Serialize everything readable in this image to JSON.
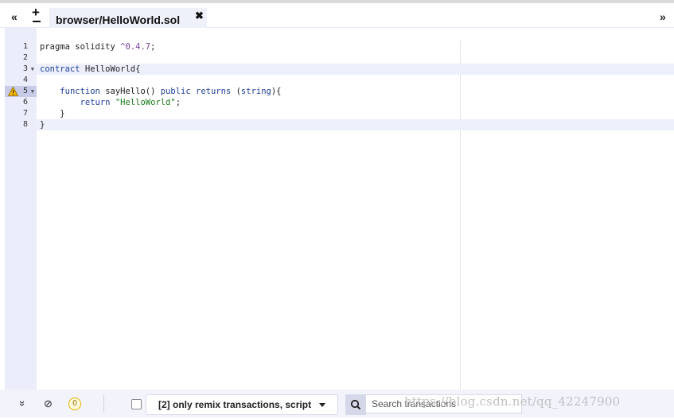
{
  "tabbar": {
    "nav_left_icon": "double-chevron-left-icon",
    "nav_left_glyph": "«",
    "plus_minus_icon": "plus-minus-icon",
    "plus_glyph": "+",
    "active_tab": {
      "label": "browser/HelloWorld.sol",
      "close_glyph": "✖"
    },
    "nav_right_icon": "double-chevron-right-icon",
    "nav_right_glyph": "»"
  },
  "editor": {
    "lines": [
      {
        "num": "1",
        "fold": ""
      },
      {
        "num": "2",
        "fold": ""
      },
      {
        "num": "3",
        "fold": "▼"
      },
      {
        "num": "4",
        "fold": ""
      },
      {
        "num": "5",
        "fold": "▼",
        "warning": true
      },
      {
        "num": "6",
        "fold": ""
      },
      {
        "num": "7",
        "fold": ""
      },
      {
        "num": "8",
        "fold": ""
      }
    ],
    "code": {
      "l1_a": "pragma solidity ",
      "l1_b": "^0.4.7",
      "l1_c": ";",
      "l3_a": "contract",
      "l3_b": " HelloWorld{",
      "l5_a": "    ",
      "l5_b": "function",
      "l5_c": " sayHello() ",
      "l5_d": "public",
      "l5_e": " ",
      "l5_f": "returns",
      "l5_g": " (",
      "l5_h": "string",
      "l5_i": "){",
      "l6_a": "        ",
      "l6_b": "return",
      "l6_c": " ",
      "l6_d": "\"HelloWorld\"",
      "l6_e": ";",
      "l7": "    }",
      "l8": "}"
    }
  },
  "bottombar": {
    "collapse_glyph": "»",
    "clear_glyph": "⊘",
    "pending_count": "0",
    "filter_label": "[2] only remix transactions, script",
    "search_placeholder": "Search transactions",
    "watermark": "https://blog.csdn.net/qq_42247900"
  },
  "colors": {
    "keyword": "#1f3f9a",
    "string": "#1a7a1a",
    "number": "#7a3e9d",
    "gutter": "#ebedfa",
    "active_tab": "#eef0fa"
  }
}
